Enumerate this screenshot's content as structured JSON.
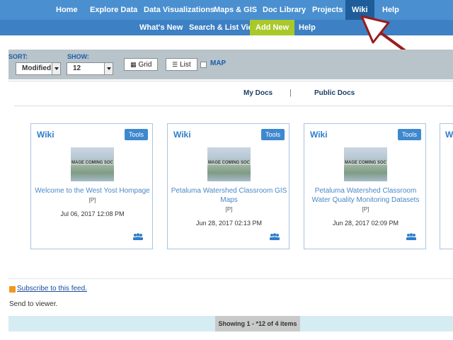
{
  "topnav": {
    "items": [
      {
        "label": "Home"
      },
      {
        "label": "Explore Data"
      },
      {
        "label": "Data Visualizations"
      },
      {
        "label": "Maps & GIS"
      },
      {
        "label": "Doc Library"
      },
      {
        "label": "Projects"
      },
      {
        "label": "Wiki"
      },
      {
        "label": "Help"
      }
    ]
  },
  "subnav": {
    "items": [
      {
        "label": "What's New"
      },
      {
        "label": "Search & List View"
      },
      {
        "label": "Add New"
      },
      {
        "label": "Help"
      }
    ]
  },
  "toolbar": {
    "sort_label": "SORT:",
    "sort_value": "Modified",
    "show_label": "SHOW:",
    "show_value": "12",
    "grid_label": "Grid",
    "list_label": "List",
    "map_label": "MAP"
  },
  "doc_tabs": {
    "my_docs": "My Docs",
    "separator": "|",
    "public_docs": "Public Docs"
  },
  "cards": [
    {
      "title": "Wiki",
      "tools": "Tools",
      "thumb_text": "MAGE COMING SOC",
      "name": "Welcome to the West Yost Hompage",
      "meta": "[P]",
      "date": "Jul 06, 2017 12:08 PM"
    },
    {
      "title": "Wiki",
      "tools": "Tools",
      "thumb_text": "MAGE COMING SOC",
      "name": "Petaluma Watershed Classroom GIS Maps",
      "meta": "[P]",
      "date": "Jun 28, 2017 02:13 PM"
    },
    {
      "title": "Wiki",
      "tools": "Tools",
      "thumb_text": "MAGE COMING SOC",
      "name": "Petaluma Watershed Classroom Water Quality Monitoring Datasets",
      "meta": "[P]",
      "date": "Jun 28, 2017 02:09 PM"
    }
  ],
  "card_partial": {
    "title": "Wi"
  },
  "feed": {
    "subscribe": "Subscribe to this feed.",
    "send_to": "Send to viewer."
  },
  "pagination": {
    "showing": "Showing 1 - *12 of 4 items"
  },
  "colors": {
    "nav_blue": "#4a8fd0",
    "subnav_blue": "#3d80c3",
    "active_wiki": "#1f5c9a",
    "add_new_green": "#a9c92a",
    "annotation_arrow": "#9b1c1c"
  }
}
